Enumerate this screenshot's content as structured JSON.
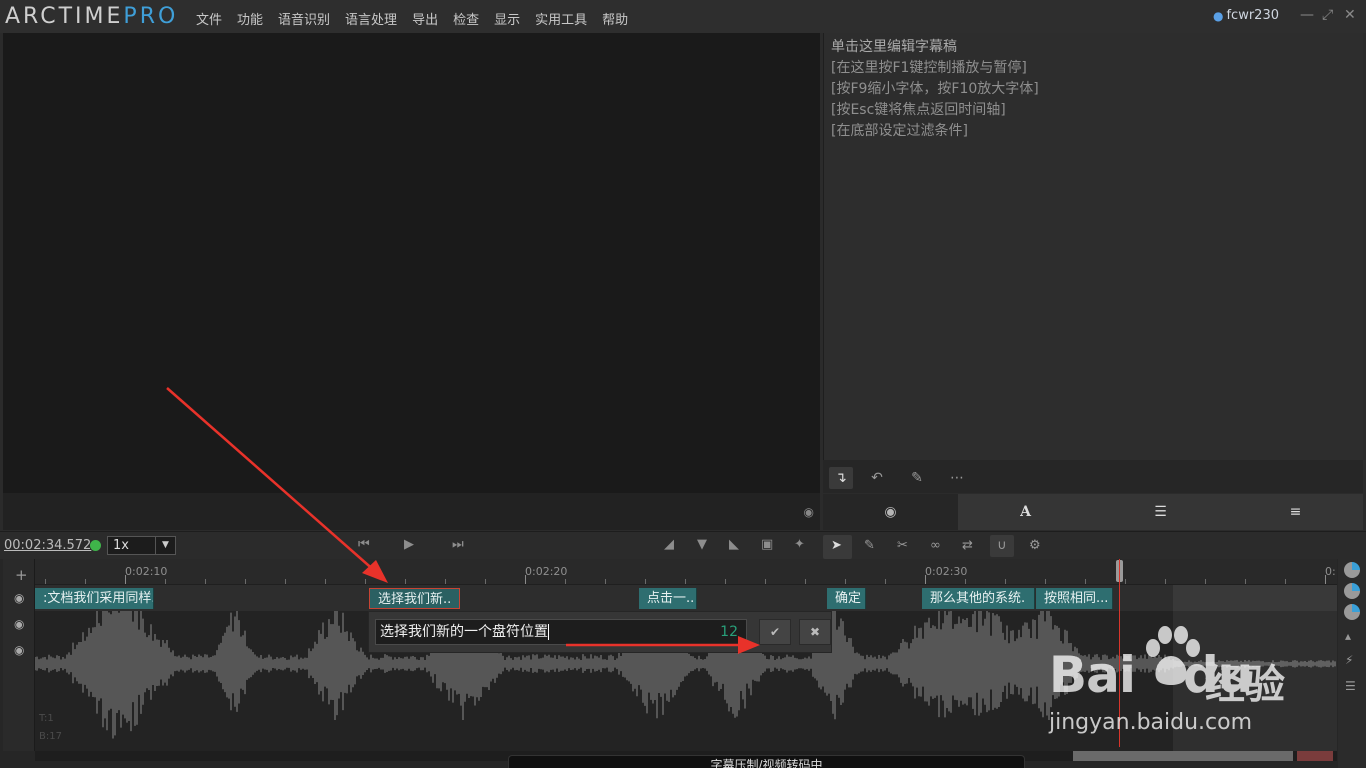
{
  "app": {
    "logo_main": "ARCTIME",
    "logo_accent": "PRO",
    "user": "fcwr230"
  },
  "menu": [
    "文件",
    "功能",
    "语音识别",
    "语言处理",
    "导出",
    "检查",
    "显示",
    "实用工具",
    "帮助"
  ],
  "editor": {
    "lines": [
      "单击这里编辑字幕稿",
      "[在这里按F1键控制播放与暂停]",
      "[按F9缩小字体，按F10放大字体]",
      "[按Esc键将焦点返回时间轴]",
      "[在底部设定过滤条件]"
    ]
  },
  "transport": {
    "time": "00:02:34.572",
    "speed": "1x",
    "status_color": "#3fb44a"
  },
  "ruler": {
    "labels": [
      "0:02:10",
      "0:02:20",
      "0:02:30",
      "0:"
    ]
  },
  "subtitles": [
    {
      "text": ":文档我们采用同样."
    },
    {
      "text": "选择我们新.."
    },
    {
      "text": "点击一.."
    },
    {
      "text": "确定"
    },
    {
      "text": "那么其他的系统."
    },
    {
      "text": "按照相同..."
    }
  ],
  "popup": {
    "text": "选择我们新的一个盘符位置",
    "count": "12"
  },
  "track_info": {
    "line1": "T:1",
    "line2": "B:17"
  },
  "status_text": "字幕压制/视频转码中",
  "watermark": {
    "brand": "Bai",
    "brand2": "du",
    "cn": "经验",
    "url": "jingyan.baidu.com"
  },
  "colors": {
    "accent": "#3f9fd8",
    "subtitle_chip": "#2e6e70",
    "selected_border": "#c84434",
    "playhead": "#d8352b",
    "arrow": "#e8322a"
  }
}
